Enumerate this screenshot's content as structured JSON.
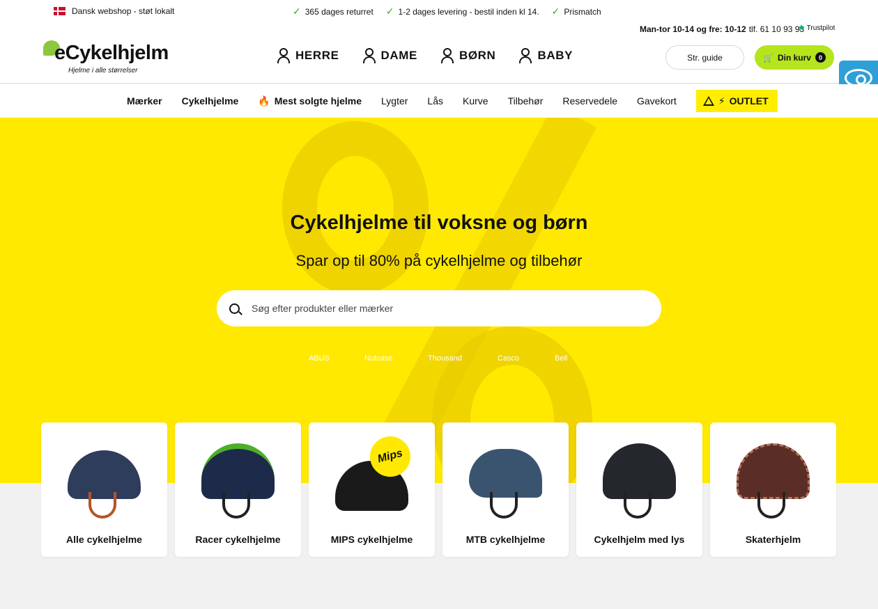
{
  "topbar": {
    "usp_left": "Dansk webshop - støt lokalt",
    "usps": [
      "365 dages returret",
      "1-2 dages levering - bestil inden kl 14.",
      "Prismatch"
    ],
    "hours_bold": "Man-tor 10-14 og fre: 10-12",
    "phone": "tlf. 61 10 93 93",
    "trustpilot": "Trustpilot"
  },
  "logo": {
    "name": "eCykelhjelm",
    "tagline": "Hjelme i alle størrelser"
  },
  "main_nav": [
    {
      "label": "HERRE",
      "icon": "man-icon"
    },
    {
      "label": "DAME",
      "icon": "woman-icon"
    },
    {
      "label": "BØRN",
      "icon": "child-icon"
    },
    {
      "label": "BABY",
      "icon": "baby-icon"
    }
  ],
  "header_buttons": {
    "size_guide": "Str. guide",
    "cart": "Din kurv",
    "cart_count": "0"
  },
  "category_nav": [
    "Mærker",
    "Cykelhjelme",
    "Mest solgte hjelme",
    "Lygter",
    "Lås",
    "Kurve",
    "Tilbehør",
    "Reservedele",
    "Gavekort",
    "OUTLET"
  ],
  "hero": {
    "title": "Cykelhjelme til voksne og børn",
    "subtitle": "Spar op til 80% på cykelhjelme og tilbehør",
    "search_placeholder": "Søg efter produkter eller mærker",
    "brands": [
      "ABUS",
      "Nutcase",
      "Thousand",
      "Casco",
      "Bell"
    ]
  },
  "cards": [
    {
      "label": "Alle cykelhjelme",
      "color": "#2f3d5c"
    },
    {
      "label": "Racer cykelhjelme",
      "color": "#1e2a4a"
    },
    {
      "label": "MIPS cykelhjelme",
      "color": "#1a1a1a",
      "badge": "Mips"
    },
    {
      "label": "MTB cykelhjelme",
      "color": "#3a5470"
    },
    {
      "label": "Cykelhjelm med lys",
      "color": "#24272c"
    },
    {
      "label": "Skaterhjelm",
      "color": "#5a2e26"
    }
  ],
  "colors": {
    "brand_green": "#b5e51d",
    "hero_yellow": "#ffe900",
    "outlet_yellow": "#ffee00",
    "check_green": "#3aa827",
    "badge_blue": "#2f9fd8"
  }
}
